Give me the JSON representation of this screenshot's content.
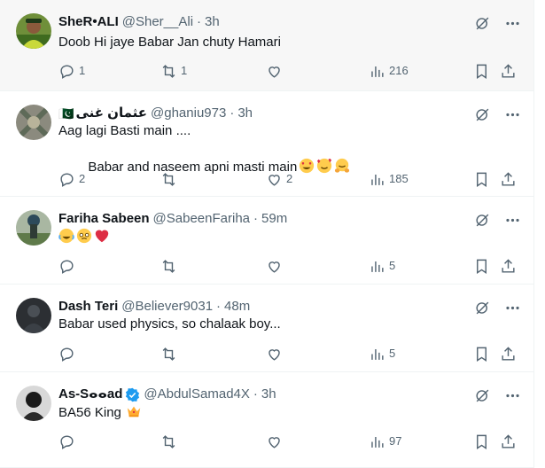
{
  "tweets": [
    {
      "display_name": "SheR•ALI",
      "flag": "",
      "handle": "@Sher__Ali",
      "time": "3h",
      "verified": false,
      "text": "Doob Hi jaye Babar Jan chuty Hamari",
      "replies": "1",
      "retweets": "1",
      "likes": "",
      "views": "216"
    },
    {
      "display_name": "عثمان غنی",
      "flag": "🇵🇰",
      "handle": "@ghaniu973",
      "time": "3h",
      "verified": false,
      "text": "Aag lagi Basti main ....",
      "text2": "Babar and naseem apni masti main",
      "emojis": [
        "heart-eyes-emoji",
        "smiling-hearts-emoji",
        "hugging-emoji"
      ],
      "replies": "2",
      "retweets": "",
      "likes": "2",
      "views": "185"
    },
    {
      "display_name": "Fariha Sabeen",
      "flag": "",
      "handle": "@SabeenFariha",
      "time": "59m",
      "verified": false,
      "text": "",
      "emojis": [
        "tears-of-joy-emoji",
        "holding-back-tears-emoji",
        "red-heart-emoji"
      ],
      "replies": "",
      "retweets": "",
      "likes": "",
      "views": "5"
    },
    {
      "display_name": "Dash Teri",
      "flag": "",
      "handle": "@Believer9031",
      "time": "48m",
      "verified": false,
      "text": "Babar used physics, so chalaak boy...",
      "replies": "",
      "retweets": "",
      "likes": "",
      "views": "5"
    },
    {
      "display_name": "As-Sⴰⴰad",
      "flag": "",
      "handle": "@AbdulSamad4X",
      "time": "3h",
      "verified": true,
      "text": "BA56 King",
      "emojis": [
        "crown-emoji"
      ],
      "replies": "",
      "retweets": "",
      "likes": "",
      "views": "97"
    }
  ],
  "colors": {
    "text_primary": "#0f1419",
    "text_secondary": "#536471",
    "verified_blue": "#1d9bf0",
    "divider": "#eff3f4",
    "hover_bg": "#f7f7f7"
  }
}
